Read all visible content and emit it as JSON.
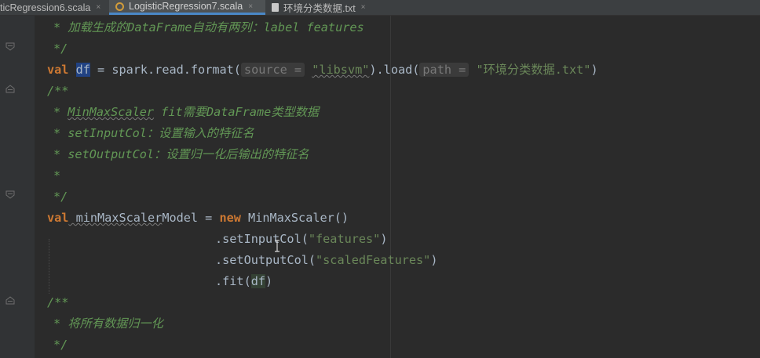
{
  "tabs": [
    {
      "label": "ticRegression6.scala",
      "close": "×",
      "icon": "none"
    },
    {
      "label": "LogisticRegression7.scala",
      "close": "×",
      "icon": "scala-object-icon",
      "active": true
    },
    {
      "label": "环境分类数据.txt",
      "close": "×",
      "icon": "text-file-icon"
    }
  ],
  "code": {
    "l1": "* 加载生成的DataFrame自动有两列：label features",
    "l2": "*/",
    "l3": {
      "val": "val",
      "var": "df",
      "mid1": " = spark.read.format(",
      "hint1": "source =",
      "str1": "\"libsvm\"",
      "mid2": ").load(",
      "hint2": "path =",
      "str2": "\"环境分类数据.txt\"",
      "end": ")"
    },
    "l4": "/**",
    "l5a": "* ",
    "l5b": "MinMaxScaler",
    "l5c": " fit需要DataFrame类型数据",
    "l6": "* setInputCol：设置输入的特征名",
    "l7": "* setOutputCol：设置归一化后输出的特征名",
    "l8": "*",
    "l9": "*/",
    "l10": {
      "val": "val",
      "name_a": " minMaxScaler",
      "name_b": "Model",
      "mid": " = ",
      "new": "new",
      "end": " MinMaxScaler()"
    },
    "l11": {
      "a": ".setInputCol(",
      "s": "\"features\"",
      "b": ")"
    },
    "l12": {
      "a": ".setOutputCol(",
      "s": "\"scaledFeatures\"",
      "b": ")"
    },
    "l13": {
      "a": ".fit(",
      "v": "df",
      "b": ")"
    },
    "l14": "/**",
    "l15": "* 将所有数据归一化",
    "l16": "*/"
  }
}
